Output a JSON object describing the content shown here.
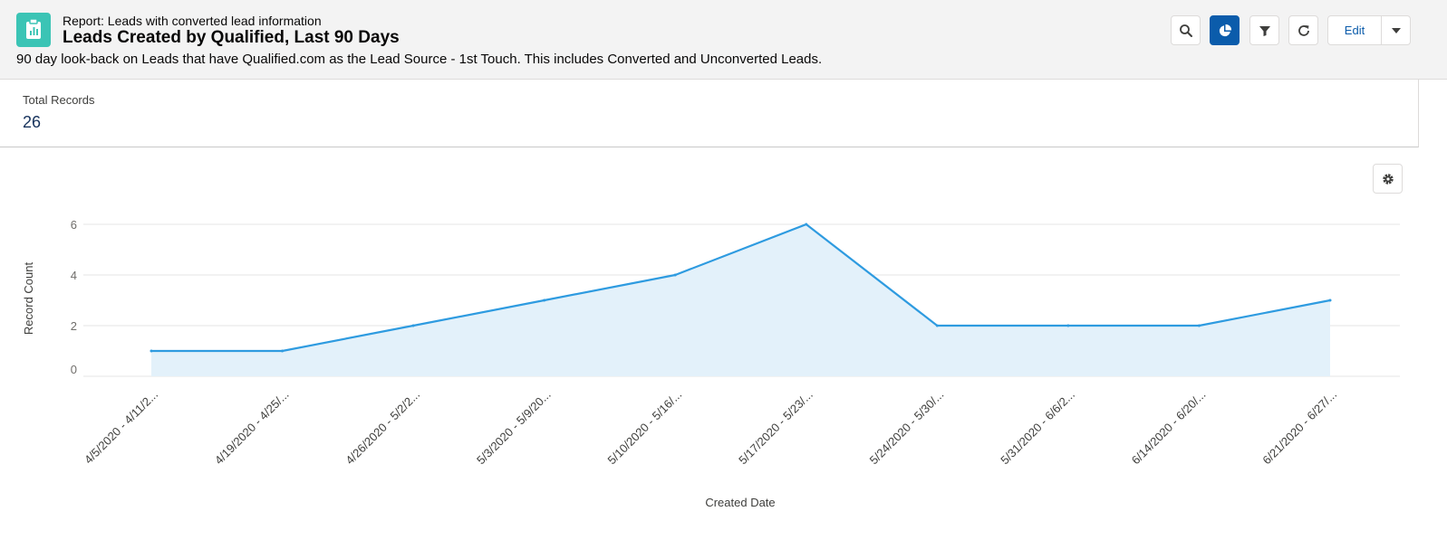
{
  "header": {
    "report_type": "Report: Leads with converted lead information",
    "title": "Leads Created by Qualified, Last 90 Days",
    "description": "90 day look-back on Leads that have Qualified.com as the Lead Source - 1st Touch. This includes Converted and Unconverted Leads.",
    "report_icon": "report-icon",
    "icon_color": "#3bc4b5",
    "toolbar": {
      "search_icon": "search-icon",
      "chart_icon": "pie-chart-icon",
      "filter_icon": "filter-icon",
      "refresh_icon": "refresh-icon",
      "edit_label": "Edit",
      "edit_menu_icon": "chevron-down-icon"
    }
  },
  "summary": {
    "total_records_label": "Total Records",
    "total_records_value": "26"
  },
  "chart_settings_icon": "gear-icon",
  "colors": {
    "accent": "#0b5cab",
    "line": "#2e9be0",
    "area": "#e3f1fa"
  },
  "chart_data": {
    "type": "area",
    "categories": [
      "4/5/2020 - 4/11/2...",
      "4/19/2020 - 4/25/...",
      "4/26/2020 - 5/2/2...",
      "5/3/2020 - 5/9/20...",
      "5/10/2020 - 5/16/...",
      "5/17/2020 - 5/23/...",
      "5/24/2020 - 5/30/...",
      "5/31/2020 - 6/6/2...",
      "6/14/2020 - 6/20/...",
      "6/21/2020 - 6/27/..."
    ],
    "values": [
      1,
      1,
      2,
      3,
      4,
      6,
      2,
      2,
      2,
      3
    ],
    "xlabel": "Created Date",
    "ylabel": "Record Count",
    "ylim": [
      0,
      6
    ],
    "yticks": [
      0,
      2,
      4,
      6
    ],
    "grid": true,
    "legend": "none"
  }
}
